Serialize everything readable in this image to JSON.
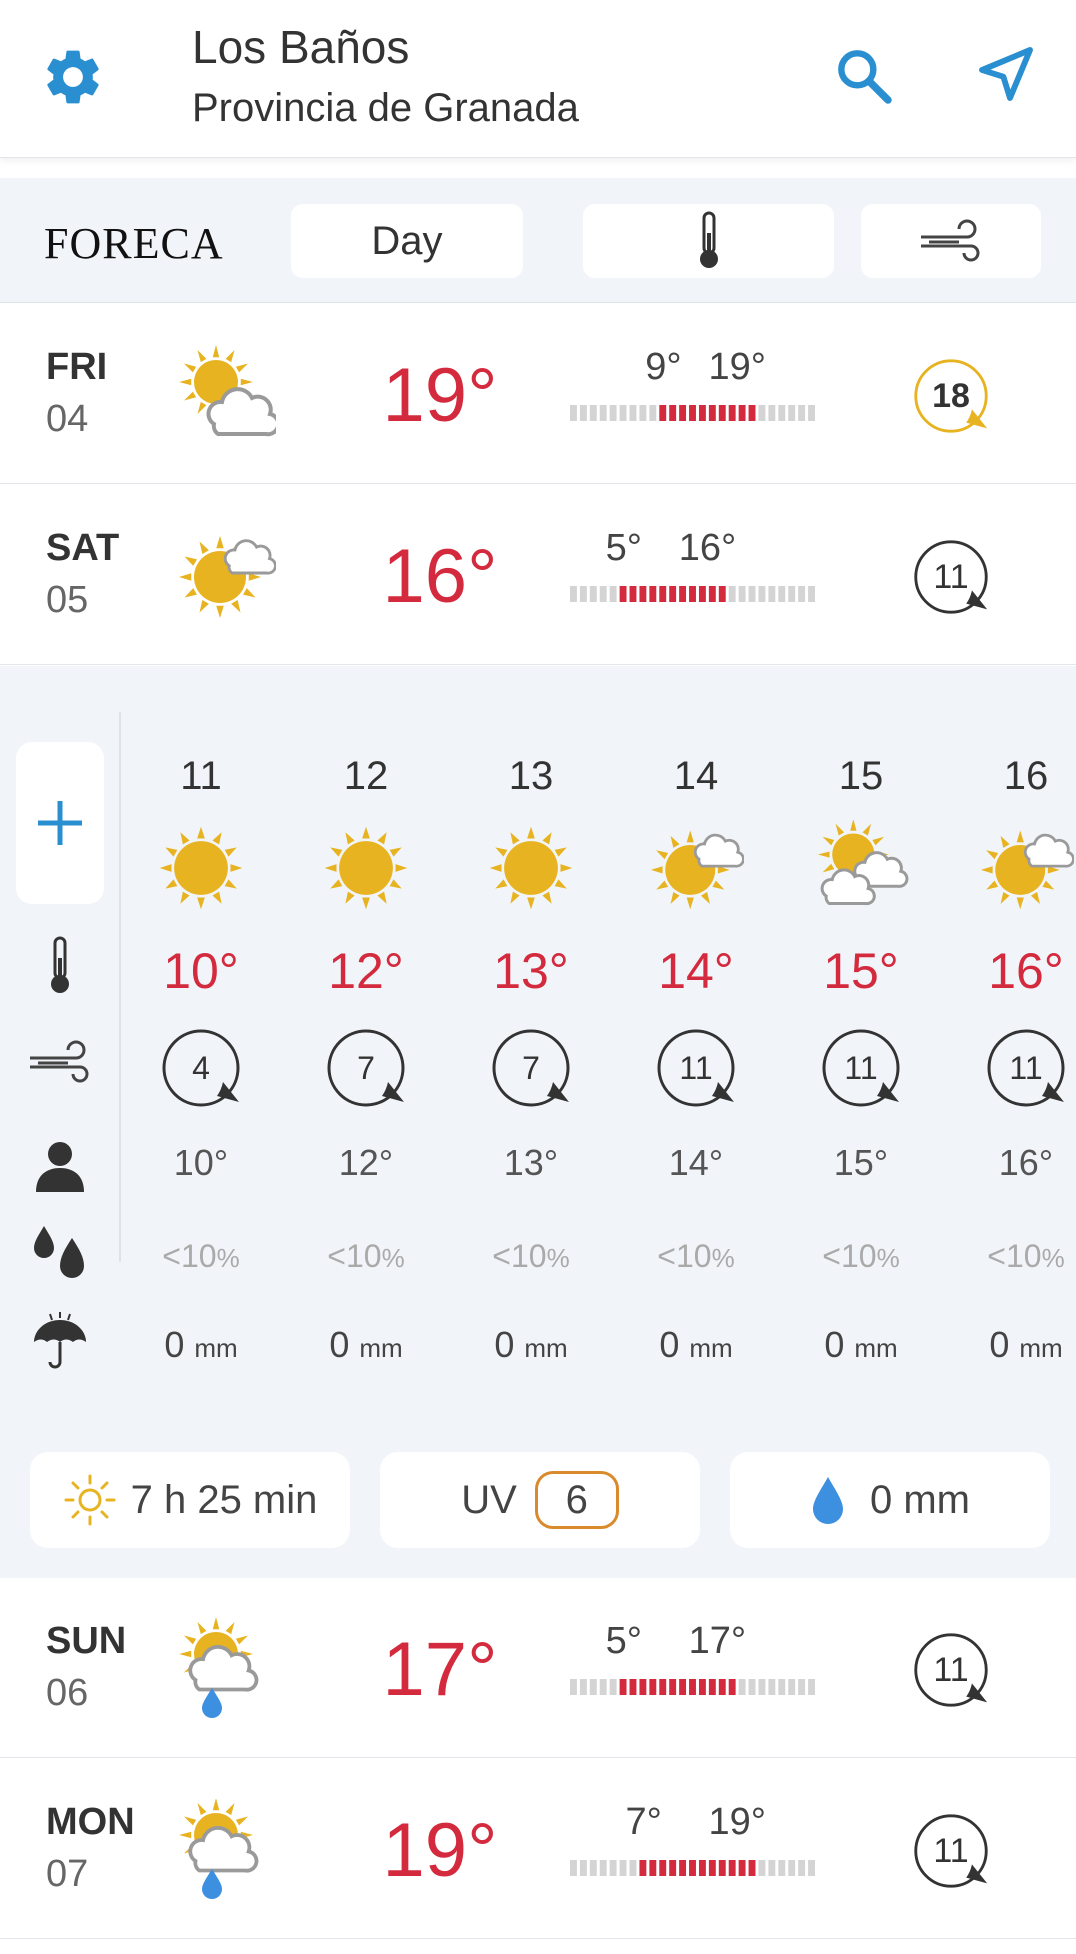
{
  "header": {
    "location": "Los Baños",
    "region": "Provincia de Granada",
    "icons": [
      "gear-icon",
      "search-icon",
      "location-arrow-icon"
    ]
  },
  "toolbar": {
    "logo": "FORECA",
    "mode_label": "Day",
    "icons": [
      "thermometer-icon",
      "wind-icon"
    ]
  },
  "days": [
    {
      "name": "FRI",
      "date": "04",
      "temp": "19°",
      "min": "9°",
      "max": "19°",
      "min_value": 9,
      "max_value": 19,
      "wind": "18",
      "wind_highlight": true,
      "icon": "sun-cloud-icon"
    },
    {
      "name": "SAT",
      "date": "05",
      "temp": "16°",
      "min": "5°",
      "max": "16°",
      "min_value": 5,
      "max_value": 16,
      "wind": "11",
      "wind_highlight": false,
      "icon": "sun-small-cloud-icon"
    },
    {
      "name": "SUN",
      "date": "06",
      "temp": "17°",
      "min": "5°",
      "max": "17°",
      "min_value": 5,
      "max_value": 17,
      "wind": "11",
      "wind_highlight": false,
      "icon": "sun-cloud-rain-icon"
    },
    {
      "name": "MON",
      "date": "07",
      "temp": "19°",
      "min": "7°",
      "max": "19°",
      "min_value": 7,
      "max_value": 19,
      "wind": "11",
      "wind_highlight": false,
      "icon": "sun-cloud-rain-icon"
    }
  ],
  "hourly": {
    "hours": [
      {
        "hour": "11",
        "temp": "10°",
        "wind": "4",
        "feels": "10°",
        "precip_prob": "<10",
        "precip_mm": "0",
        "icon": "sun-icon"
      },
      {
        "hour": "12",
        "temp": "12°",
        "wind": "7",
        "feels": "12°",
        "precip_prob": "<10",
        "precip_mm": "0",
        "icon": "sun-icon"
      },
      {
        "hour": "13",
        "temp": "13°",
        "wind": "7",
        "feels": "13°",
        "precip_prob": "<10",
        "precip_mm": "0",
        "icon": "sun-icon"
      },
      {
        "hour": "14",
        "temp": "14°",
        "wind": "11",
        "feels": "14°",
        "precip_prob": "<10",
        "precip_mm": "0",
        "icon": "sun-small-cloud-icon"
      },
      {
        "hour": "15",
        "temp": "15°",
        "wind": "11",
        "feels": "15°",
        "precip_prob": "<10",
        "precip_mm": "0",
        "icon": "sun-clouds-icon"
      },
      {
        "hour": "16",
        "temp": "16°",
        "wind": "11",
        "feels": "16°",
        "precip_prob": "<10",
        "precip_mm": "0",
        "icon": "sun-small-cloud-icon"
      }
    ],
    "percent_unit": "%",
    "mm_unit": "mm",
    "row_icons": [
      "plus-icon",
      "thermometer-icon",
      "wind-icon",
      "person-icon",
      "drops-icon",
      "umbrella-icon"
    ]
  },
  "summary": {
    "sunshine": "7 h 25 min",
    "uv_label": "UV",
    "uv_value": "6",
    "precip": "0 mm"
  },
  "colors": {
    "accent_blue": "#2a8fd1",
    "temp_red": "#d42a3e",
    "sun_yellow": "#e8b320",
    "uv_orange": "#d98a2b",
    "bg_light": "#f1f5f9"
  }
}
